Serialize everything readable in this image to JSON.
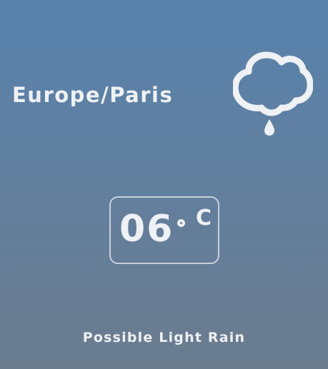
{
  "location": "Europe/Paris",
  "weather": {
    "icon": "rain-cloud-icon",
    "temperature": "06",
    "unit": "C",
    "condition": "Possible Light Rain"
  },
  "colors": {
    "background_top": "#5882ad",
    "background_bottom": "#6b7c8e",
    "foreground": "#eef1f5"
  }
}
